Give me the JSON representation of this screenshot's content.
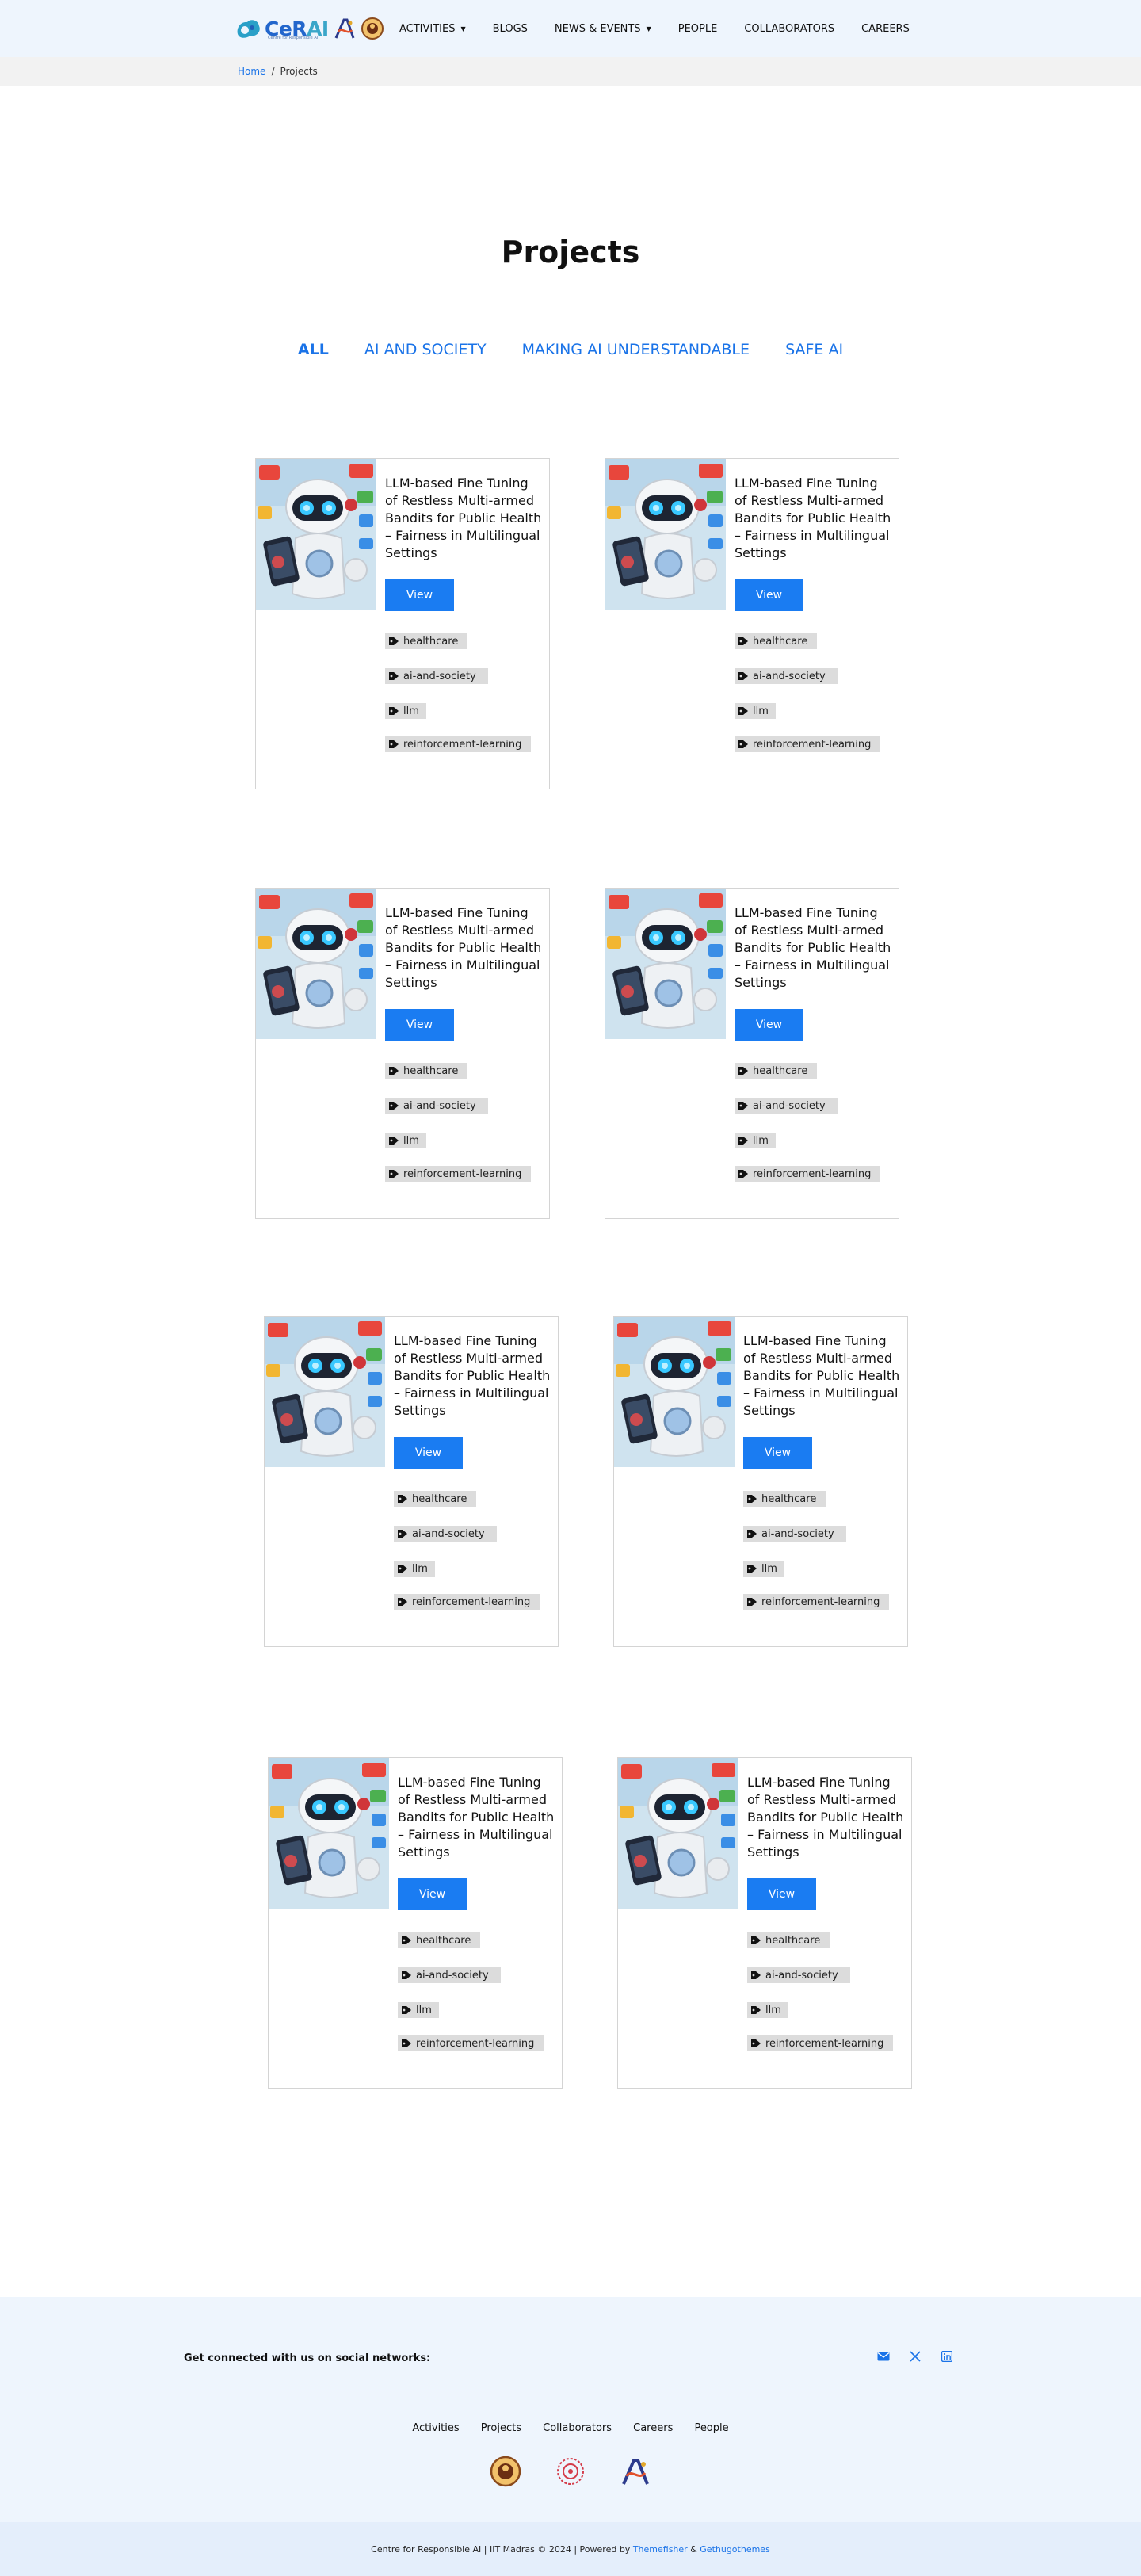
{
  "brand": {
    "name_main": "CeR",
    "name_accent": "AI",
    "tagline": "Centre for Responsible AI"
  },
  "nav": {
    "items": [
      {
        "label": "ACTIVITIES",
        "dropdown": true
      },
      {
        "label": "BLOGS",
        "dropdown": false
      },
      {
        "label": "NEWS & EVENTS",
        "dropdown": true
      },
      {
        "label": "PEOPLE",
        "dropdown": false
      },
      {
        "label": "COLLABORATORS",
        "dropdown": false
      },
      {
        "label": "CAREERS",
        "dropdown": false
      }
    ]
  },
  "breadcrumb": {
    "home": "Home",
    "separator": "/",
    "current": "Projects"
  },
  "page": {
    "title": "Projects"
  },
  "filters": [
    {
      "label": "ALL",
      "active": true
    },
    {
      "label": "AI AND SOCIETY",
      "active": false
    },
    {
      "label": "MAKING AI UNDERSTANDABLE",
      "active": false
    },
    {
      "label": "SAFE AI",
      "active": false
    }
  ],
  "projects": [
    {
      "title": "LLM-based Fine Tuning of Restless Multi-armed Bandits for Public Health – Fairness in Multilingual Settings",
      "button": "View",
      "tags": [
        "healthcare",
        "ai-and-society",
        "llm",
        "reinforcement-learning"
      ]
    },
    {
      "title": "LLM-based Fine Tuning of Restless Multi-armed Bandits for Public Health – Fairness in Multilingual Settings",
      "button": "View",
      "tags": [
        "healthcare",
        "ai-and-society",
        "llm",
        "reinforcement-learning"
      ]
    },
    {
      "title": "LLM-based Fine Tuning of Restless Multi-armed Bandits for Public Health – Fairness in Multilingual Settings",
      "button": "View",
      "tags": [
        "healthcare",
        "ai-and-society",
        "llm",
        "reinforcement-learning"
      ]
    },
    {
      "title": "LLM-based Fine Tuning of Restless Multi-armed Bandits for Public Health – Fairness in Multilingual Settings",
      "button": "View",
      "tags": [
        "healthcare",
        "ai-and-society",
        "llm",
        "reinforcement-learning"
      ]
    },
    {
      "title": "LLM-based Fine Tuning of Restless Multi-armed Bandits for Public Health – Fairness in Multilingual Settings",
      "button": "View",
      "tags": [
        "healthcare",
        "ai-and-society",
        "llm",
        "reinforcement-learning"
      ]
    },
    {
      "title": "LLM-based Fine Tuning of Restless Multi-armed Bandits for Public Health – Fairness in Multilingual Settings",
      "button": "View",
      "tags": [
        "healthcare",
        "ai-and-society",
        "llm",
        "reinforcement-learning"
      ]
    },
    {
      "title": "LLM-based Fine Tuning of Restless Multi-armed Bandits for Public Health – Fairness in Multilingual Settings",
      "button": "View",
      "tags": [
        "healthcare",
        "ai-and-society",
        "llm",
        "reinforcement-learning"
      ]
    },
    {
      "title": "LLM-based Fine Tuning of Restless Multi-armed Bandits for Public Health – Fairness in Multilingual Settings",
      "button": "View",
      "tags": [
        "healthcare",
        "ai-and-society",
        "llm",
        "reinforcement-learning"
      ]
    }
  ],
  "footer": {
    "social_text": "Get connected with us on social networks:",
    "social_icons": [
      "email-icon",
      "x-twitter-icon",
      "linkedin-icon"
    ],
    "links": [
      "Activities",
      "Projects",
      "Collaborators",
      "Careers",
      "People"
    ],
    "copyright_prefix": "Centre for Responsible AI | IIT Madras © 2024 | Powered by",
    "powered_by_1": "Themefisher",
    "amp": "&",
    "powered_by_2": "Gethugothemes"
  },
  "colors": {
    "accent": "#1a7cf2",
    "header_bg": "#eef5fd",
    "tag_bg": "#dcdcdc"
  }
}
